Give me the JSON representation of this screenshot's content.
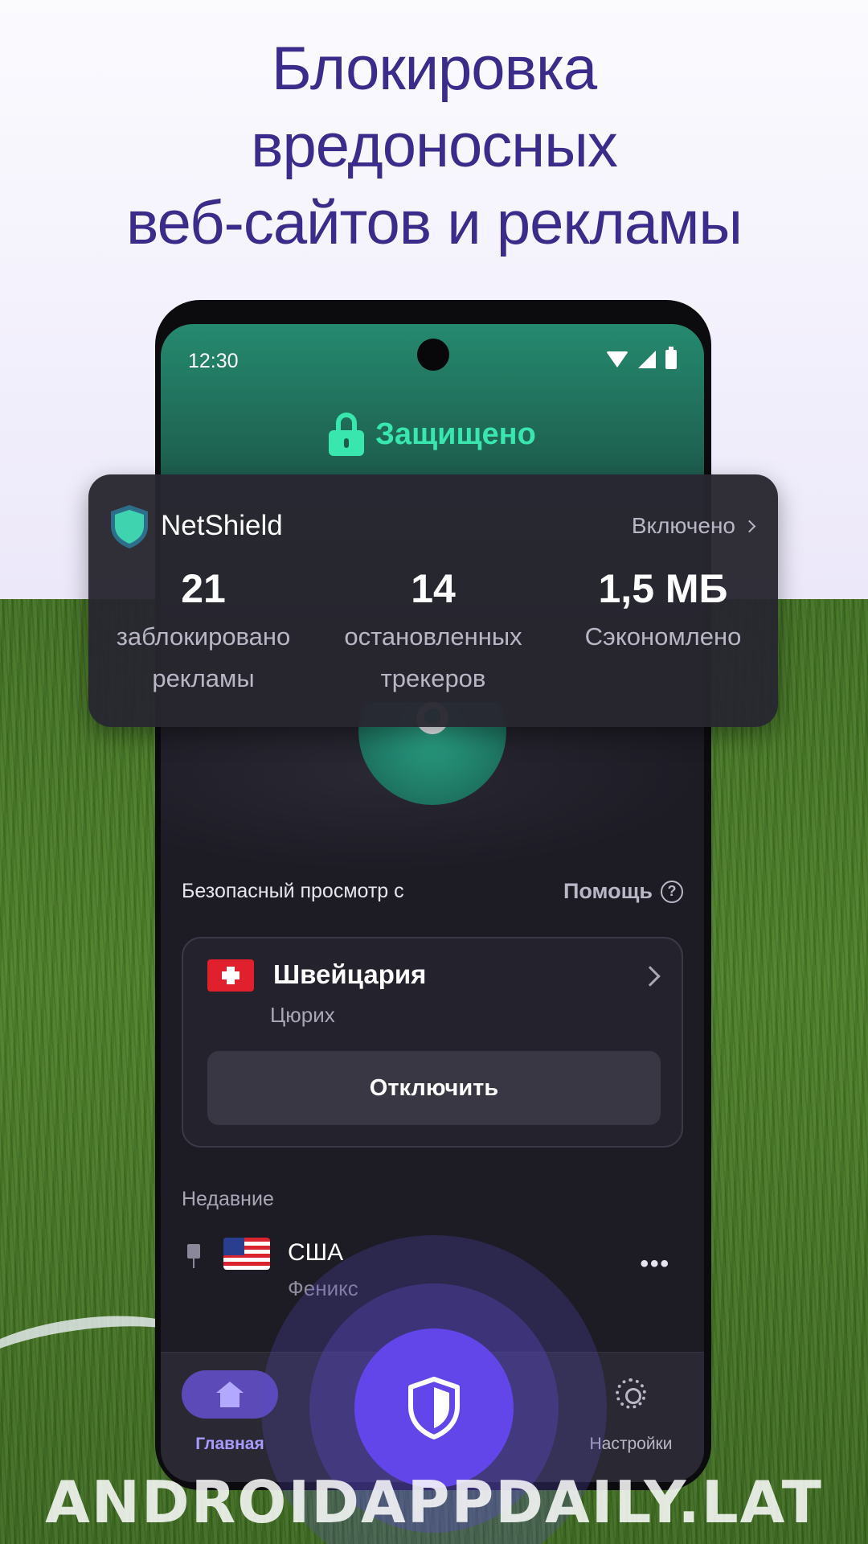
{
  "headline": {
    "line1": "Блокировка",
    "line2": "вредоносных",
    "line3": "веб-сайтов и рекламы"
  },
  "status_bar": {
    "time": "12:30"
  },
  "connection": {
    "status": "Защищено",
    "accent": "#38e6ae"
  },
  "netshield": {
    "title": "NetShield",
    "status": "Включено",
    "stats": [
      {
        "value": "21",
        "label_line1": "заблокировано",
        "label_line2": "рекламы"
      },
      {
        "value": "14",
        "label_line1": "остановленных",
        "label_line2": "трекеров"
      },
      {
        "value": "1,5 МБ",
        "label_line1": "Сэкономлено",
        "label_line2": ""
      }
    ]
  },
  "safe_browsing": {
    "label": "Безопасный просмотр с",
    "help": "Помощь"
  },
  "server": {
    "country": "Швейцария",
    "city": "Цюрих",
    "disconnect_label": "Отключить"
  },
  "recent": {
    "label": "Недавние",
    "items": [
      {
        "country": "США",
        "city": "Феникс"
      }
    ]
  },
  "bottom_nav": {
    "home_label": "Главная",
    "settings_label": "Настройки",
    "accent": "#6246ea"
  },
  "watermark": "ANDROIDAPPDAILY.LAT"
}
